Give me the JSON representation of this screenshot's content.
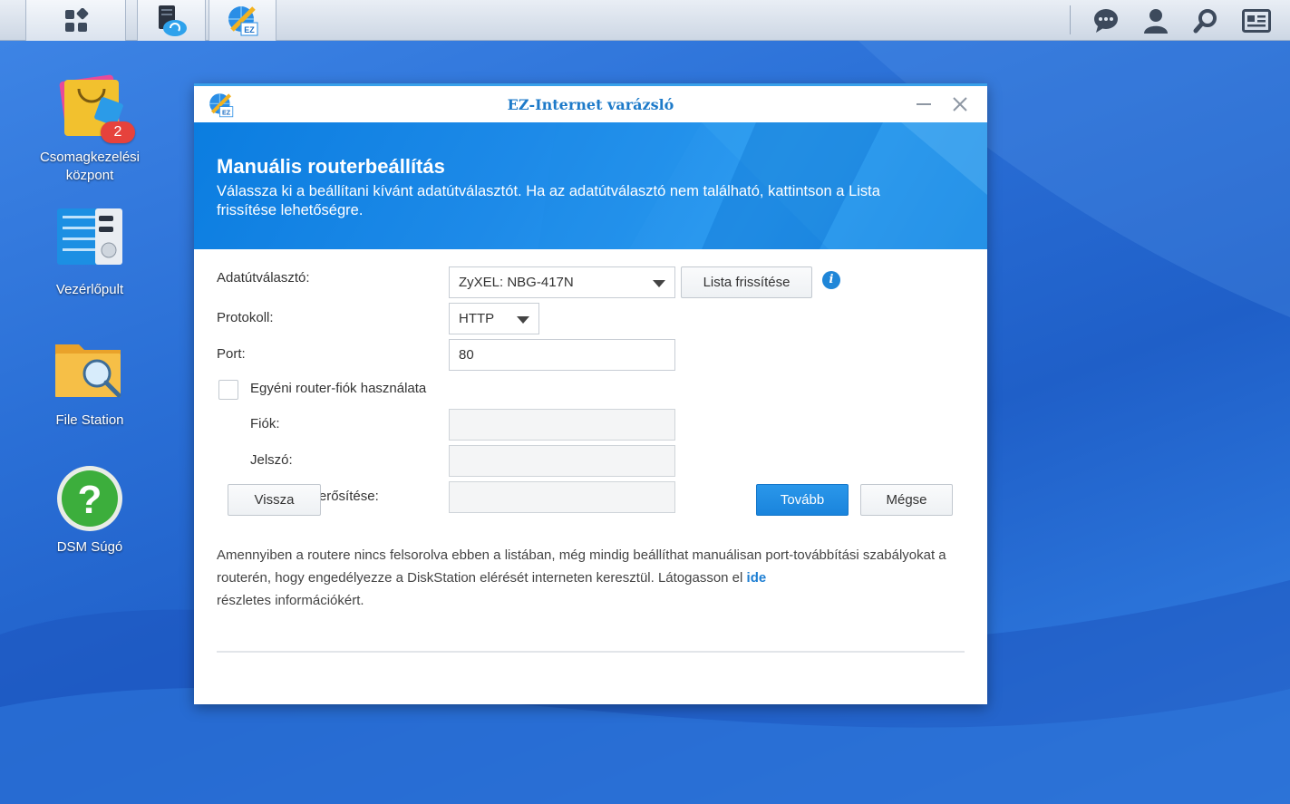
{
  "taskbar": {
    "icons": [
      "main-menu-icon",
      "cloud-sync-icon",
      "ez-internet-icon",
      "chat-icon",
      "user-icon",
      "search-icon",
      "widgets-icon"
    ]
  },
  "desktop": {
    "icons": [
      {
        "label": "Csomagkezelési központ",
        "badge": "2"
      },
      {
        "label": "Vezérlőpult"
      },
      {
        "label": "File Station"
      },
      {
        "label": "DSM Súgó"
      }
    ]
  },
  "window": {
    "title": "EZ-Internet varázsló",
    "accent": "#39a0e9",
    "banner": {
      "heading": "Manuális routerbeállítás",
      "description": "Válassza ki a beállítani kívánt adatútválasztót. Ha az adatútválasztó nem található, kattintson a Lista frissítése lehetőségre."
    },
    "form": {
      "router_label": "Adatútválasztó:",
      "router_value": "ZyXEL: NBG-417N",
      "refresh_button": "Lista frissítése",
      "protocol_label": "Protokoll:",
      "protocol_value": "HTTP",
      "port_label": "Port:",
      "port_value": "80",
      "custom_account_label": "Egyéni router-fiók használata",
      "custom_account_checked": false,
      "account_label": "Fiók:",
      "account_value": "",
      "password_label": "Jelszó:",
      "password_value": "",
      "confirm_label": "Jelszó megerősítése:",
      "confirm_value": ""
    },
    "note": {
      "text": "Amennyiben a routere nincs felsorolva ebben a listában, még mindig beállíthat manuálisan port-továbbítási szabályokat a routerén, hogy engedélyezze a DiskStation elérését interneten keresztül. Látogasson el",
      "link": "ide",
      "after": "részletes információkért."
    },
    "buttons": {
      "back": "Vissza",
      "next": "Tovább",
      "cancel": "Mégse"
    }
  }
}
